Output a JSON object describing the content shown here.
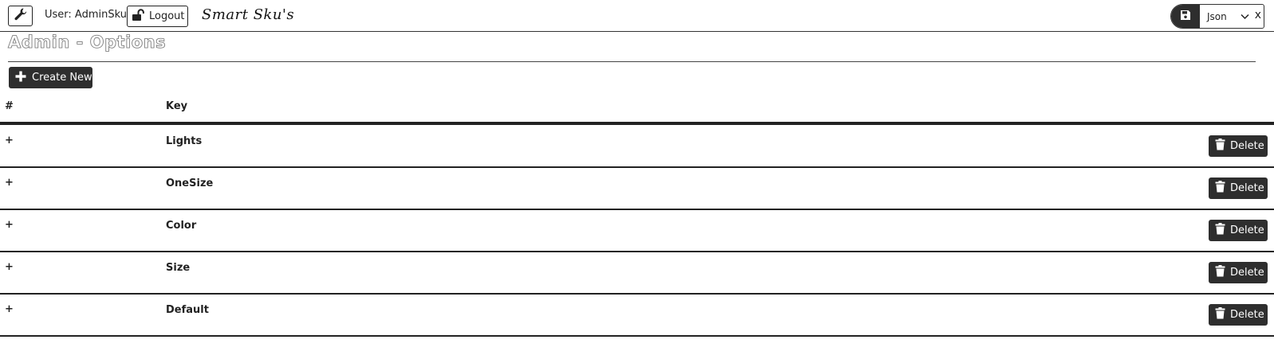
{
  "header": {
    "user_label": "User: AdminSku",
    "logout_label": "Logout",
    "brand": "Smart Sku's",
    "export": {
      "format": "Json",
      "close": "x"
    }
  },
  "page": {
    "title": "Admin - Options",
    "create_label": "Create New"
  },
  "table": {
    "columns": [
      "#",
      "Key"
    ],
    "rows": [
      {
        "expand": "+",
        "key": "Lights",
        "action": "Delete"
      },
      {
        "expand": "+",
        "key": "OneSize",
        "action": "Delete"
      },
      {
        "expand": "+",
        "key": "Color",
        "action": "Delete"
      },
      {
        "expand": "+",
        "key": "Size",
        "action": "Delete"
      },
      {
        "expand": "+",
        "key": "Default",
        "action": "Delete"
      }
    ]
  },
  "icons": {
    "settings": "wrench-icon",
    "logout": "unlock-icon",
    "save": "floppy-icon",
    "dropdown": "chevron-down-icon",
    "create": "plus-icon",
    "delete": "trash-icon"
  },
  "colors": {
    "button_dark": "#2e2e2e",
    "text": "#222222",
    "background": "#ffffff"
  }
}
